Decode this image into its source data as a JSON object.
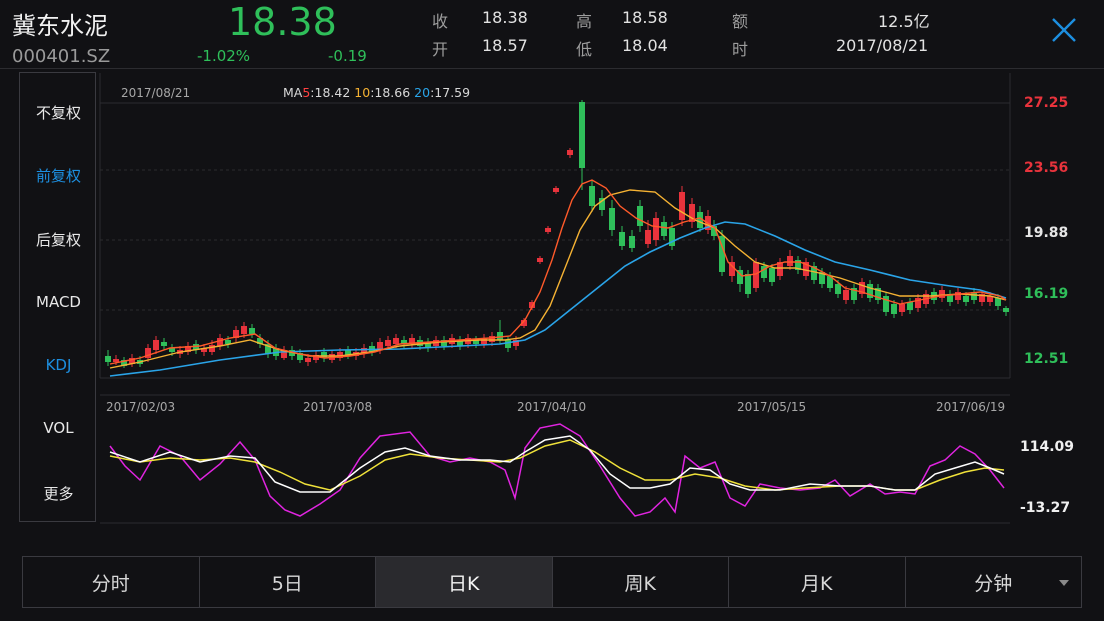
{
  "header": {
    "name": "冀东水泥",
    "code": "000401.SZ",
    "price": "18.38",
    "change_pct": "-1.02%",
    "change": "-0.19",
    "fields": [
      {
        "label": "收",
        "value": "18.38"
      },
      {
        "label": "开",
        "value": "18.57"
      },
      {
        "label": "高",
        "value": "18.58"
      },
      {
        "label": "低",
        "value": "18.04"
      },
      {
        "label": "额",
        "value": "12.5亿"
      },
      {
        "label": "时",
        "value": "2017/08/21"
      }
    ]
  },
  "menu": {
    "items": [
      "不复权",
      "前复权",
      "后复权",
      "MACD",
      "KDJ",
      "VOL",
      "更多"
    ],
    "active": [
      "前复权",
      "KDJ"
    ]
  },
  "chart": {
    "date_label": "2017/08/21",
    "ma_prefix": "MA",
    "ma": [
      {
        "period": "5",
        "value": ":18.42",
        "color": "#ff4040"
      },
      {
        "period": "10",
        "value": ":18.66",
        "color": "#f5b233"
      },
      {
        "period": "20",
        "value": ":17.59",
        "color": "#2aa4e8"
      }
    ],
    "price_axis": [
      "27.25",
      "23.56",
      "19.88",
      "16.19",
      "12.51"
    ],
    "price_axis_colors": [
      "#e8333c",
      "#e8333c",
      "#e6e6e6",
      "#2fbf5a",
      "#2fbf5a"
    ],
    "x_dates": [
      "2017/02/03",
      "2017/03/08",
      "2017/04/10",
      "2017/05/15",
      "2017/06/19"
    ],
    "kdj_axis": [
      "114.09",
      "-13.27"
    ]
  },
  "tabs": [
    "分时",
    "5日",
    "日K",
    "周K",
    "月K",
    "分钟"
  ],
  "active_tab": "日K",
  "colors": {
    "up": "#e8333c",
    "down": "#2fbf5a",
    "accent": "#1d8fe0",
    "ma5": "#ff5a2a",
    "ma10": "#f5b233",
    "ma20": "#2aa4e8",
    "k_line": "#ffffff",
    "d_line": "#f0e23a",
    "j_line": "#e024e0"
  }
}
